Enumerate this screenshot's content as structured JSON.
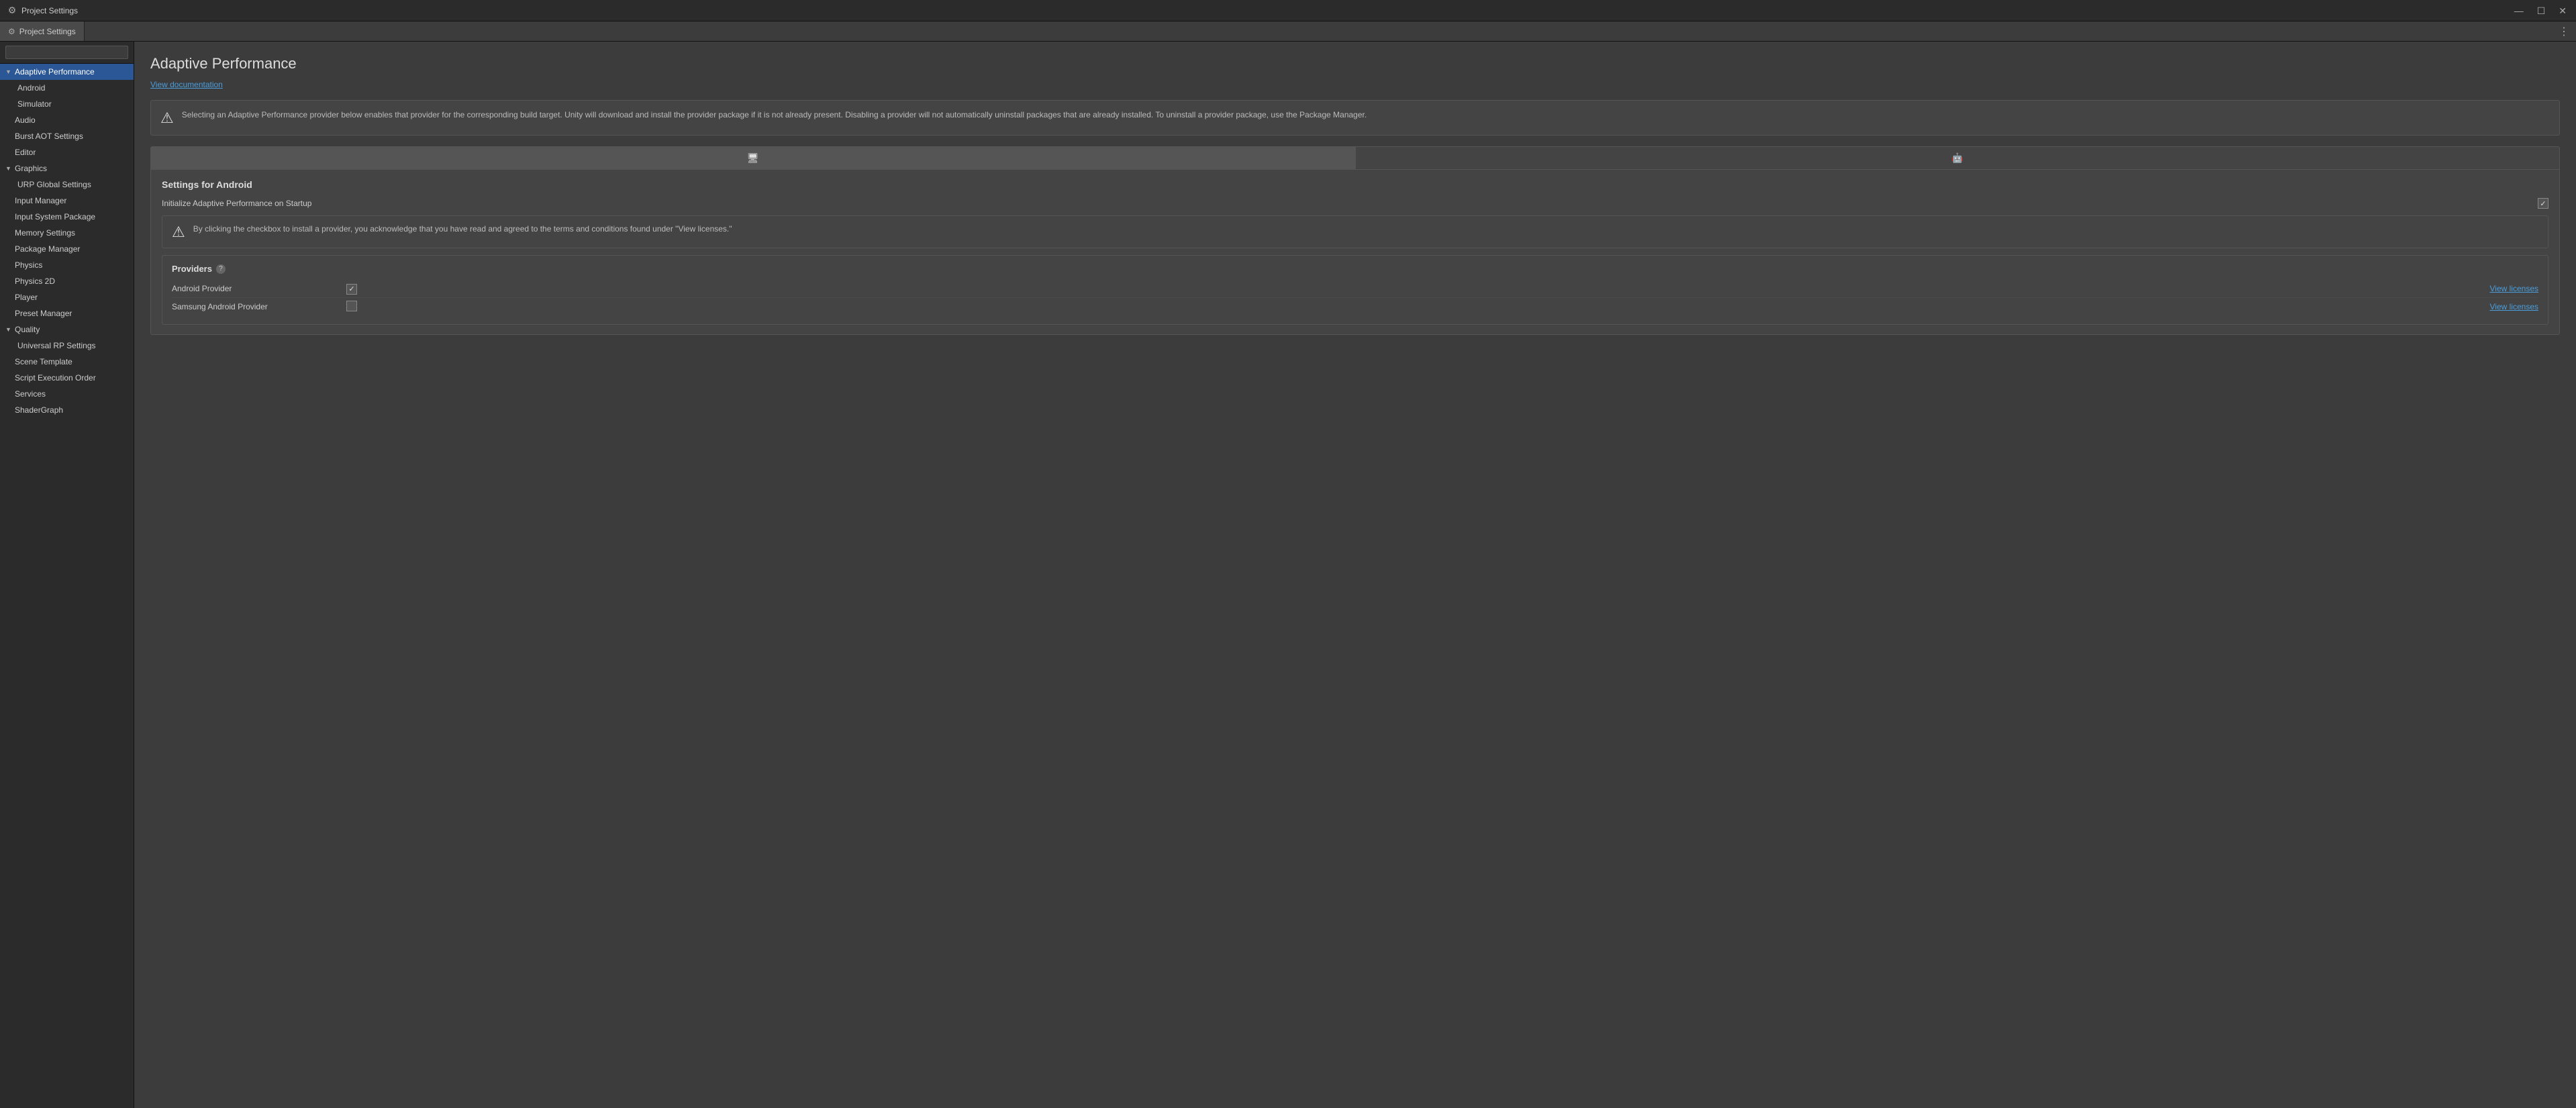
{
  "window": {
    "title": "Project Settings",
    "controls": {
      "minimize": "—",
      "maximize": "☐",
      "close": "✕"
    }
  },
  "tab_bar": {
    "active_tab": "Project Settings",
    "tabs": [
      {
        "label": "Project Settings",
        "icon": "gear"
      }
    ],
    "dots": "⋮"
  },
  "search": {
    "placeholder": ""
  },
  "sidebar": {
    "items": [
      {
        "id": "adaptive-performance",
        "label": "Adaptive Performance",
        "type": "parent-open",
        "active": true
      },
      {
        "id": "android",
        "label": "Android",
        "type": "child",
        "active": false
      },
      {
        "id": "simulator",
        "label": "Simulator",
        "type": "child",
        "active": false
      },
      {
        "id": "audio",
        "label": "Audio",
        "type": "root",
        "active": false
      },
      {
        "id": "burst-aot",
        "label": "Burst AOT Settings",
        "type": "root",
        "active": false
      },
      {
        "id": "editor",
        "label": "Editor",
        "type": "root",
        "active": false
      },
      {
        "id": "graphics",
        "label": "Graphics",
        "type": "parent-open",
        "active": false
      },
      {
        "id": "urp-global",
        "label": "URP Global Settings",
        "type": "child",
        "active": false
      },
      {
        "id": "input-manager",
        "label": "Input Manager",
        "type": "root",
        "active": false
      },
      {
        "id": "input-system",
        "label": "Input System Package",
        "type": "root",
        "active": false
      },
      {
        "id": "memory-settings",
        "label": "Memory Settings",
        "type": "root",
        "active": false
      },
      {
        "id": "package-manager",
        "label": "Package Manager",
        "type": "root",
        "active": false
      },
      {
        "id": "physics",
        "label": "Physics",
        "type": "root",
        "active": false
      },
      {
        "id": "physics-2d",
        "label": "Physics 2D",
        "type": "root",
        "active": false
      },
      {
        "id": "player",
        "label": "Player",
        "type": "root",
        "active": false
      },
      {
        "id": "preset-manager",
        "label": "Preset Manager",
        "type": "root",
        "active": false
      },
      {
        "id": "quality",
        "label": "Quality",
        "type": "parent-open",
        "active": false
      },
      {
        "id": "universal-rp",
        "label": "Universal RP Settings",
        "type": "child",
        "active": false
      },
      {
        "id": "scene-template",
        "label": "Scene Template",
        "type": "root",
        "active": false
      },
      {
        "id": "script-execution",
        "label": "Script Execution Order",
        "type": "root",
        "active": false
      },
      {
        "id": "services",
        "label": "Services",
        "type": "root",
        "active": false
      },
      {
        "id": "shader-graph",
        "label": "ShaderGraph",
        "type": "root",
        "active": false
      }
    ]
  },
  "content": {
    "title": "Adaptive Performance",
    "view_docs_label": "View documentation",
    "info_message": "Selecting an Adaptive Performance provider below enables that provider for the corresponding build target. Unity will download and install the provider package if it is not already present. Disabling a provider will not automatically uninstall packages that are already installed. To uninstall a provider package, use the Package Manager.",
    "tabs": [
      {
        "id": "desktop",
        "label": "desktop",
        "icon": "desktop",
        "active": true
      },
      {
        "id": "android",
        "label": "android",
        "icon": "android",
        "active": false
      }
    ],
    "settings_for": "Settings for Android",
    "initialize_label": "Initialize Adaptive Performance on Startup",
    "initialize_checked": true,
    "warning_message": "By clicking the checkbox to install a provider, you acknowledge that you have read and agreed to the terms and conditions found under \"View licenses.\"",
    "providers": {
      "title": "Providers",
      "items": [
        {
          "name": "Android Provider",
          "checked": true,
          "view_licenses_label": "View licenses"
        },
        {
          "name": "Samsung Android Provider",
          "checked": false,
          "view_licenses_label": "View licenses"
        }
      ]
    }
  }
}
